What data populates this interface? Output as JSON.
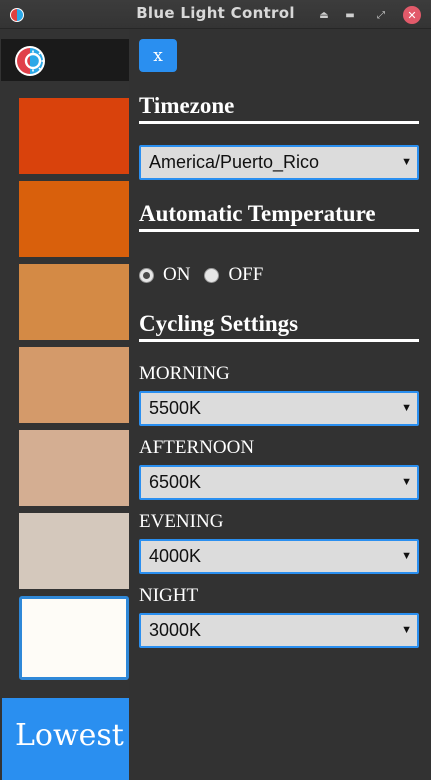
{
  "window": {
    "title": "Blue Light Control",
    "controls": [
      "eject-icon",
      "minimize-icon",
      "restore-icon",
      "close-icon"
    ]
  },
  "colors": {
    "accent": "#2a8ff0",
    "swatches": [
      "#d9420c",
      "#d9600c",
      "#d48a45",
      "#d49a6a",
      "#d4ae92",
      "#d4c8bc",
      "#fefcf7"
    ]
  },
  "sidebar": {
    "selected_swatch_index": 6,
    "banner_text": "Lowest value"
  },
  "main": {
    "close_label": "x",
    "timezone": {
      "heading": "Timezone",
      "value": "America/Puerto_Rico"
    },
    "automatic": {
      "heading": "Automatic Temperature",
      "on_label": "ON",
      "off_label": "OFF",
      "selected": "ON"
    },
    "cycling": {
      "heading": "Cycling Settings",
      "morning_label": "MORNING",
      "morning_value": "5500K",
      "afternoon_label": "AFTERNOON",
      "afternoon_value": "6500K",
      "evening_label": "EVENING",
      "evening_value": "4000K",
      "night_label": "NIGHT",
      "night_value": "3000K"
    }
  }
}
